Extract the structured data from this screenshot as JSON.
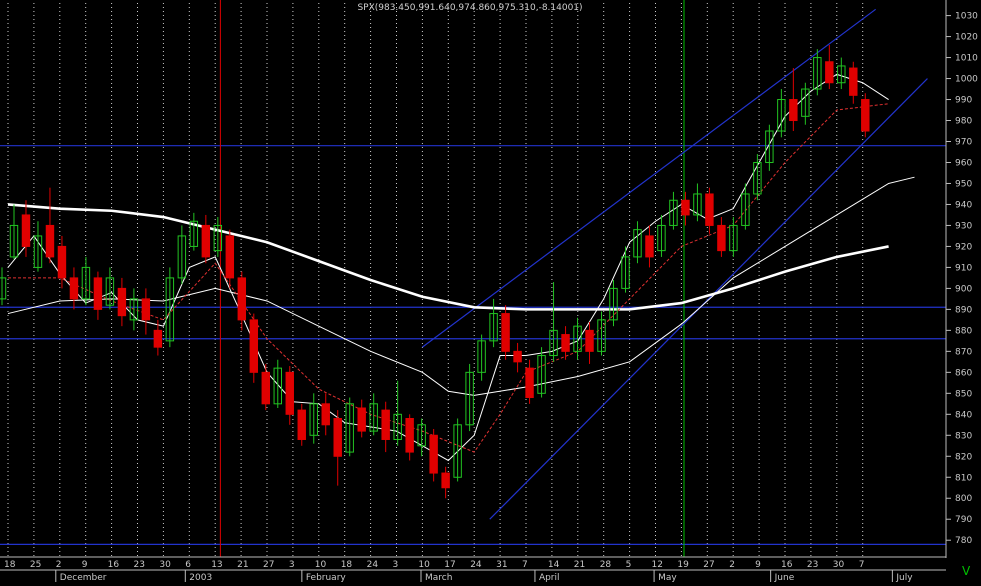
{
  "chart_data": {
    "type": "candlestick",
    "title": "SPX(983.450,991.640,974.860,975.310,-8.14001)",
    "ylim": [
      772,
      1036
    ],
    "y_ticks": [
      780,
      790,
      800,
      810,
      820,
      830,
      840,
      850,
      860,
      870,
      880,
      890,
      900,
      910,
      920,
      930,
      940,
      950,
      960,
      970,
      980,
      990,
      1000,
      1010,
      1020,
      1030
    ],
    "x_day_ticks": [
      "18",
      "25",
      "2",
      "9",
      "16",
      "23",
      "30",
      "6",
      "13",
      "21",
      "27",
      "3",
      "10",
      "18",
      "24",
      "3",
      "10",
      "17",
      "24",
      "31",
      "7",
      "14",
      "21",
      "28",
      "5",
      "12",
      "19",
      "27",
      "2",
      "9",
      "16",
      "23",
      "30",
      "7"
    ],
    "x_month_labels": [
      "December",
      "2003",
      "February",
      "March",
      "April",
      "May",
      "June",
      "July"
    ],
    "corner_marker": "V",
    "horizontal_levels": [
      968,
      891,
      876,
      778
    ],
    "trend_channel": {
      "upper_start": {
        "week": 16.0,
        "value": 872
      },
      "upper_end": {
        "week": 33.5,
        "value": 1033
      },
      "lower_start": {
        "week": 18.6,
        "value": 790
      },
      "lower_end": {
        "week": 35.5,
        "value": 1000
      }
    },
    "vertical_markers": [
      {
        "week": 8.2,
        "color": "#e00000"
      },
      {
        "week": 26.1,
        "color": "#00c000"
      }
    ],
    "series": [
      {
        "name": "",
        "color": "#ffffff",
        "values": [
          [
            0,
            940
          ],
          [
            2,
            938
          ],
          [
            4,
            937
          ],
          [
            6,
            934
          ],
          [
            8,
            928
          ],
          [
            10,
            922
          ],
          [
            12,
            913
          ],
          [
            14,
            904
          ],
          [
            16,
            896
          ],
          [
            18,
            891
          ],
          [
            20,
            890
          ],
          [
            22,
            890
          ],
          [
            24,
            890
          ],
          [
            26,
            893
          ],
          [
            28,
            900
          ],
          [
            30,
            908
          ],
          [
            32,
            915
          ],
          [
            34,
            920
          ]
        ]
      },
      {
        "name": "",
        "color": "#ffffff",
        "values": [
          [
            0,
            888
          ],
          [
            2,
            894
          ],
          [
            4,
            895
          ],
          [
            6,
            894
          ],
          [
            8,
            900
          ],
          [
            10,
            894
          ],
          [
            12,
            882
          ],
          [
            14,
            870
          ],
          [
            16,
            860
          ],
          [
            17,
            851
          ],
          [
            18,
            849
          ],
          [
            20,
            853
          ],
          [
            22,
            858
          ],
          [
            24,
            865
          ],
          [
            26,
            883
          ],
          [
            28,
            905
          ],
          [
            30,
            920
          ],
          [
            32,
            935
          ],
          [
            34,
            950
          ],
          [
            35,
            953
          ]
        ]
      },
      {
        "name": "",
        "color": "#ffffff",
        "values": [
          [
            0,
            910
          ],
          [
            1,
            925
          ],
          [
            2,
            907
          ],
          [
            3,
            893
          ],
          [
            4,
            898
          ],
          [
            5,
            885
          ],
          [
            6,
            882
          ],
          [
            7,
            910
          ],
          [
            8,
            915
          ],
          [
            9,
            888
          ],
          [
            10,
            860
          ],
          [
            11,
            846
          ],
          [
            12,
            845
          ],
          [
            13,
            836
          ],
          [
            14,
            834
          ],
          [
            15,
            832
          ],
          [
            16,
            825
          ],
          [
            17,
            818
          ],
          [
            18,
            830
          ],
          [
            19,
            868
          ],
          [
            20,
            868
          ],
          [
            21,
            870
          ],
          [
            22,
            875
          ],
          [
            23,
            895
          ],
          [
            24,
            922
          ],
          [
            25,
            932
          ],
          [
            26,
            940
          ],
          [
            27,
            933
          ],
          [
            28,
            938
          ],
          [
            29,
            960
          ],
          [
            30,
            982
          ],
          [
            31,
            994
          ],
          [
            32,
            1002
          ],
          [
            33,
            998
          ],
          [
            34,
            990
          ]
        ]
      },
      {
        "name": "",
        "color": "#e03030",
        "values": [
          [
            0,
            905
          ],
          [
            2,
            905
          ],
          [
            4,
            894
          ],
          [
            6,
            885
          ],
          [
            8,
            912
          ],
          [
            10,
            876
          ],
          [
            12,
            852
          ],
          [
            14,
            840
          ],
          [
            16,
            832
          ],
          [
            18,
            822
          ],
          [
            19,
            840
          ],
          [
            20,
            860
          ],
          [
            22,
            870
          ],
          [
            24,
            895
          ],
          [
            26,
            920
          ],
          [
            28,
            930
          ],
          [
            30,
            960
          ],
          [
            32,
            985
          ],
          [
            34,
            988
          ]
        ]
      }
    ],
    "candles": [
      {
        "open": 895,
        "close": 905,
        "high": 910,
        "low": 892
      },
      {
        "open": 915,
        "close": 930,
        "high": 940,
        "low": 914
      },
      {
        "open": 935,
        "close": 920,
        "high": 942,
        "low": 915
      },
      {
        "open": 910,
        "close": 925,
        "high": 932,
        "low": 908
      },
      {
        "open": 930,
        "close": 915,
        "high": 948,
        "low": 912
      },
      {
        "open": 920,
        "close": 905,
        "high": 925,
        "low": 900
      },
      {
        "open": 905,
        "close": 895,
        "high": 910,
        "low": 890
      },
      {
        "open": 895,
        "close": 910,
        "high": 915,
        "low": 892
      },
      {
        "open": 905,
        "close": 890,
        "high": 908,
        "low": 885
      },
      {
        "open": 892,
        "close": 905,
        "high": 910,
        "low": 890
      },
      {
        "open": 900,
        "close": 887,
        "high": 905,
        "low": 882
      },
      {
        "open": 885,
        "close": 895,
        "high": 900,
        "low": 880
      },
      {
        "open": 895,
        "close": 885,
        "high": 900,
        "low": 878
      },
      {
        "open": 880,
        "close": 872,
        "high": 885,
        "low": 868
      },
      {
        "open": 875,
        "close": 905,
        "high": 910,
        "low": 872
      },
      {
        "open": 905,
        "close": 925,
        "high": 930,
        "low": 902
      },
      {
        "open": 920,
        "close": 932,
        "high": 936,
        "low": 918
      },
      {
        "open": 930,
        "close": 915,
        "high": 935,
        "low": 912
      },
      {
        "open": 918,
        "close": 930,
        "high": 934,
        "low": 915
      },
      {
        "open": 925,
        "close": 905,
        "high": 928,
        "low": 900
      },
      {
        "open": 905,
        "close": 885,
        "high": 908,
        "low": 880
      },
      {
        "open": 885,
        "close": 860,
        "high": 888,
        "low": 855
      },
      {
        "open": 860,
        "close": 845,
        "high": 864,
        "low": 842
      },
      {
        "open": 845,
        "close": 862,
        "high": 866,
        "low": 843
      },
      {
        "open": 860,
        "close": 840,
        "high": 863,
        "low": 835
      },
      {
        "open": 842,
        "close": 828,
        "high": 845,
        "low": 825
      },
      {
        "open": 830,
        "close": 845,
        "high": 850,
        "low": 826
      },
      {
        "open": 845,
        "close": 835,
        "high": 850,
        "low": 830
      },
      {
        "open": 838,
        "close": 820,
        "high": 842,
        "low": 806
      },
      {
        "open": 822,
        "close": 845,
        "high": 848,
        "low": 820
      },
      {
        "open": 843,
        "close": 832,
        "high": 847,
        "low": 829
      },
      {
        "open": 832,
        "close": 845,
        "high": 850,
        "low": 830
      },
      {
        "open": 842,
        "close": 828,
        "high": 846,
        "low": 822
      },
      {
        "open": 828,
        "close": 840,
        "high": 856,
        "low": 825
      },
      {
        "open": 838,
        "close": 822,
        "high": 840,
        "low": 818
      },
      {
        "open": 825,
        "close": 835,
        "high": 838,
        "low": 820
      },
      {
        "open": 830,
        "close": 812,
        "high": 833,
        "low": 808
      },
      {
        "open": 812,
        "close": 805,
        "high": 815,
        "low": 800
      },
      {
        "open": 810,
        "close": 835,
        "high": 838,
        "low": 808
      },
      {
        "open": 835,
        "close": 860,
        "high": 864,
        "low": 832
      },
      {
        "open": 860,
        "close": 875,
        "high": 878,
        "low": 856
      },
      {
        "open": 875,
        "close": 888,
        "high": 895,
        "low": 872
      },
      {
        "open": 888,
        "close": 870,
        "high": 892,
        "low": 866
      },
      {
        "open": 870,
        "close": 865,
        "high": 874,
        "low": 860
      },
      {
        "open": 862,
        "close": 848,
        "high": 866,
        "low": 845
      },
      {
        "open": 850,
        "close": 868,
        "high": 872,
        "low": 848
      },
      {
        "open": 868,
        "close": 880,
        "high": 903,
        "low": 865
      },
      {
        "open": 878,
        "close": 870,
        "high": 882,
        "low": 866
      },
      {
        "open": 870,
        "close": 882,
        "high": 886,
        "low": 866
      },
      {
        "open": 880,
        "close": 870,
        "high": 884,
        "low": 864
      },
      {
        "open": 870,
        "close": 885,
        "high": 889,
        "low": 868
      },
      {
        "open": 885,
        "close": 900,
        "high": 904,
        "low": 882
      },
      {
        "open": 900,
        "close": 915,
        "high": 920,
        "low": 898
      },
      {
        "open": 915,
        "close": 928,
        "high": 932,
        "low": 912
      },
      {
        "open": 925,
        "close": 915,
        "high": 930,
        "low": 910
      },
      {
        "open": 918,
        "close": 930,
        "high": 935,
        "low": 915
      },
      {
        "open": 930,
        "close": 942,
        "high": 946,
        "low": 928
      },
      {
        "open": 942,
        "close": 935,
        "high": 946,
        "low": 930
      },
      {
        "open": 935,
        "close": 945,
        "high": 950,
        "low": 932
      },
      {
        "open": 945,
        "close": 930,
        "high": 948,
        "low": 926
      },
      {
        "open": 930,
        "close": 918,
        "high": 934,
        "low": 915
      },
      {
        "open": 918,
        "close": 930,
        "high": 934,
        "low": 915
      },
      {
        "open": 930,
        "close": 945,
        "high": 950,
        "low": 928
      },
      {
        "open": 945,
        "close": 960,
        "high": 964,
        "low": 942
      },
      {
        "open": 960,
        "close": 975,
        "high": 978,
        "low": 956
      },
      {
        "open": 975,
        "close": 990,
        "high": 995,
        "low": 972
      },
      {
        "open": 990,
        "close": 980,
        "high": 1005,
        "low": 975
      },
      {
        "open": 982,
        "close": 995,
        "high": 998,
        "low": 978
      },
      {
        "open": 995,
        "close": 1010,
        "high": 1014,
        "low": 992
      },
      {
        "open": 1008,
        "close": 998,
        "high": 1016,
        "low": 995
      },
      {
        "open": 998,
        "close": 1006,
        "high": 1010,
        "low": 995
      },
      {
        "open": 1005,
        "close": 992,
        "high": 1008,
        "low": 988
      },
      {
        "open": 990,
        "close": 975,
        "high": 993,
        "low": 972
      }
    ]
  }
}
